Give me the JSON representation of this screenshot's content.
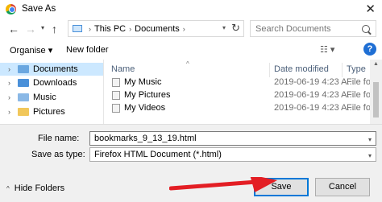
{
  "window": {
    "title": "Save As",
    "close_glyph": "✕",
    "icon": "chrome-icon"
  },
  "nav": {
    "back_glyph": "←",
    "forward_glyph": "→",
    "recent_glyph": "▾",
    "up_glyph": "↑",
    "breadcrumb": [
      "This PC",
      "Documents"
    ],
    "breadcrumb_sep": "›",
    "dropdown_glyph": "▾",
    "refresh_glyph": "↻",
    "search_placeholder": "Search Documents"
  },
  "toolbar": {
    "organise_label": "Organise ▾",
    "new_folder_label": "New folder",
    "view_label": "☷ ▾",
    "help_label": "?"
  },
  "sidebar": {
    "items": [
      {
        "label": "Documents",
        "chevron": "›",
        "icon": "documents-icon",
        "selected": true
      },
      {
        "label": "Downloads",
        "chevron": "›",
        "icon": "downloads-icon",
        "selected": false
      },
      {
        "label": "Music",
        "chevron": "›",
        "icon": "music-icon",
        "selected": false
      },
      {
        "label": "Pictures",
        "chevron": "›",
        "icon": "pictures-icon",
        "selected": false
      }
    ]
  },
  "files": {
    "sort_caret": "^",
    "headers": {
      "name": "Name",
      "date": "Date modified",
      "type": "Type"
    },
    "rows": [
      {
        "name": "My Music",
        "date": "2019-06-19 4:23 A...",
        "type": "File fol"
      },
      {
        "name": "My Pictures",
        "date": "2019-06-19 4:23 A...",
        "type": "File fol"
      },
      {
        "name": "My Videos",
        "date": "2019-06-19 4:23 A...",
        "type": "File fol"
      }
    ]
  },
  "save": {
    "filename_label": "File name:",
    "filename_value": "bookmarks_9_13_19.html",
    "type_label": "Save as type:",
    "type_value": "Firefox HTML Document (*.html)",
    "caret_glyph": "▾",
    "hide_folders_label": "Hide Folders",
    "hide_caret": "^",
    "save_label": "Save",
    "cancel_label": "Cancel"
  },
  "colors": {
    "accent": "#0078d7",
    "selection": "#cce8ff",
    "annotation_arrow": "#e31e24"
  }
}
